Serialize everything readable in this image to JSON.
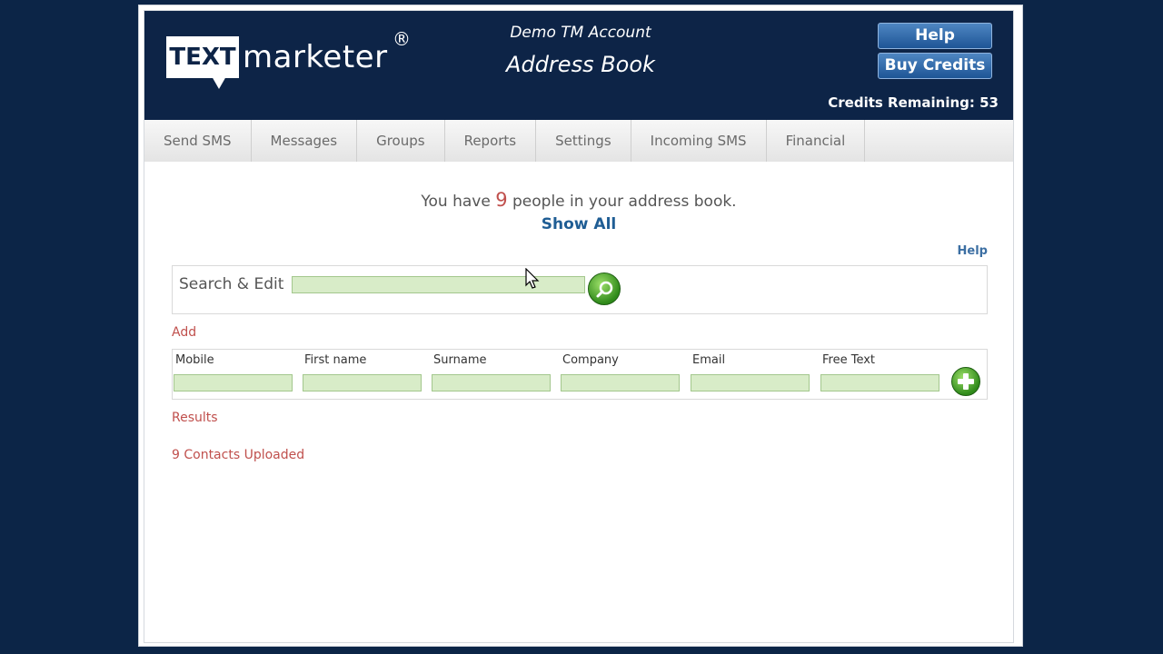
{
  "header": {
    "logo_box_text": "TEXT",
    "logo_word": "marketer",
    "logo_reg": "®",
    "account_name": "Demo TM Account",
    "page_heading": "Address Book",
    "help_button": "Help",
    "buy_credits_button": "Buy Credits",
    "credits_text": "Credits Remaining: 53"
  },
  "nav": {
    "items": [
      {
        "label": "Send SMS"
      },
      {
        "label": "Messages"
      },
      {
        "label": "Groups"
      },
      {
        "label": "Reports"
      },
      {
        "label": "Settings"
      },
      {
        "label": "Incoming SMS"
      },
      {
        "label": "Financial"
      }
    ]
  },
  "summary": {
    "prefix": "You have ",
    "count": "9",
    "suffix": " people in your address book."
  },
  "show_all": "Show All",
  "help_link": "Help",
  "search": {
    "label": "Search & Edit",
    "value": ""
  },
  "add": {
    "label": "Add",
    "fields": [
      {
        "label": "Mobile",
        "value": ""
      },
      {
        "label": "First name",
        "value": ""
      },
      {
        "label": "Surname",
        "value": ""
      },
      {
        "label": "Company",
        "value": ""
      },
      {
        "label": "Email",
        "value": ""
      },
      {
        "label": "Free Text",
        "value": ""
      }
    ]
  },
  "results": {
    "label": "Results",
    "status": "9 Contacts Uploaded"
  },
  "colors": {
    "background": "#0c2547",
    "header": "#0d2447",
    "accent_red": "#c0504d",
    "link_blue": "#1f5d94",
    "input_green": "#d8ecc8"
  },
  "icons": {
    "search_button": "magnifier-icon",
    "add_button": "plus-icon"
  }
}
